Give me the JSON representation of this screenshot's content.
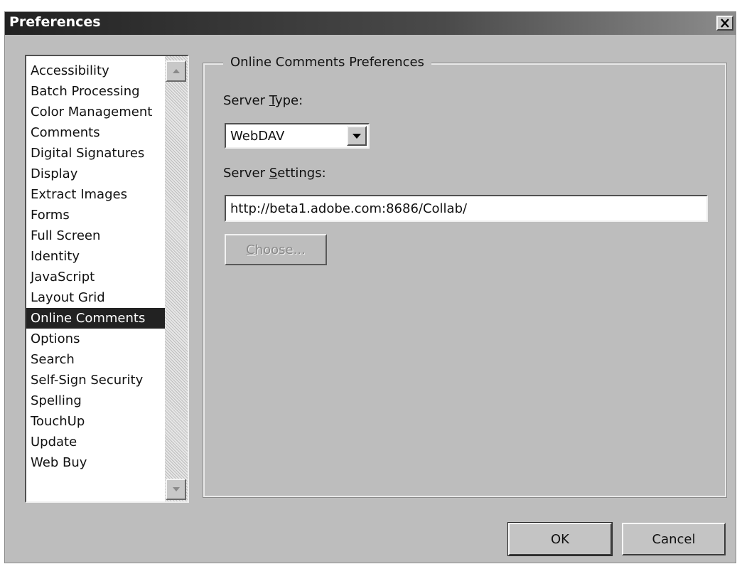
{
  "window": {
    "title": "Preferences",
    "close_icon": "close-icon"
  },
  "categories": {
    "items": [
      "Accessibility",
      "Batch Processing",
      "Color Management",
      "Comments",
      "Digital Signatures",
      "Display",
      "Extract Images",
      "Forms",
      "Full Screen",
      "Identity",
      "JavaScript",
      "Layout Grid",
      "Online Comments",
      "Options",
      "Search",
      "Self-Sign Security",
      "Spelling",
      "TouchUp",
      "Update",
      "Web Buy"
    ],
    "selected": "Online Comments",
    "selected_color": "#222222"
  },
  "panel": {
    "group_title": "Online Comments Preferences",
    "server_type_label_pre": "Server ",
    "server_type_label_mnemonic": "T",
    "server_type_label_post": "ype:",
    "server_type_value": "WebDAV",
    "server_settings_label_pre": "Server ",
    "server_settings_label_mnemonic": "S",
    "server_settings_label_post": "ettings:",
    "server_settings_value": "http://beta1.adobe.com:8686/Collab/",
    "choose_mnemonic": "C",
    "choose_rest": "hoose..."
  },
  "buttons": {
    "ok": "OK",
    "cancel": "Cancel"
  }
}
